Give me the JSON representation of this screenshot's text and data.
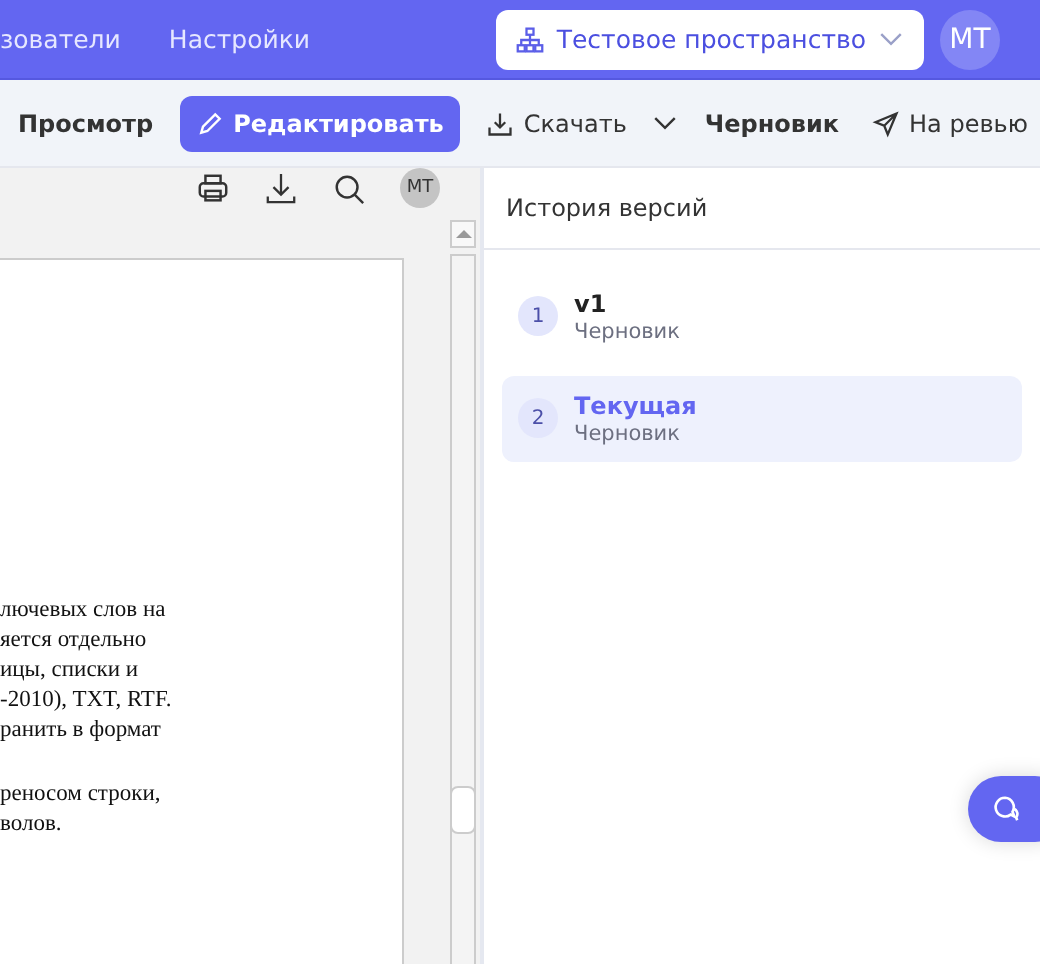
{
  "top_nav": {
    "links": [
      "зователи",
      "Настройки"
    ],
    "workspace": "Тестовое пространство",
    "avatar": "МТ"
  },
  "toolbar": {
    "view": "Просмотр",
    "edit": "Редактировать",
    "download": "Скачать",
    "status": "Черновик",
    "review": "На ревью"
  },
  "viewer": {
    "avatar": "MT",
    "paragraphs": [
      [
        "лючевых слов на",
        "яется отдельно",
        "ицы, списки и",
        "-2010), TXT, RTF.",
        "ранить в формат"
      ],
      [
        "реносом строки,",
        "волов."
      ]
    ]
  },
  "history": {
    "title": "История версий",
    "versions": [
      {
        "number": "1",
        "name": "v1",
        "status": "Черновик",
        "selected": false
      },
      {
        "number": "2",
        "name": "Текущая",
        "status": "Черновик",
        "selected": true
      }
    ]
  }
}
